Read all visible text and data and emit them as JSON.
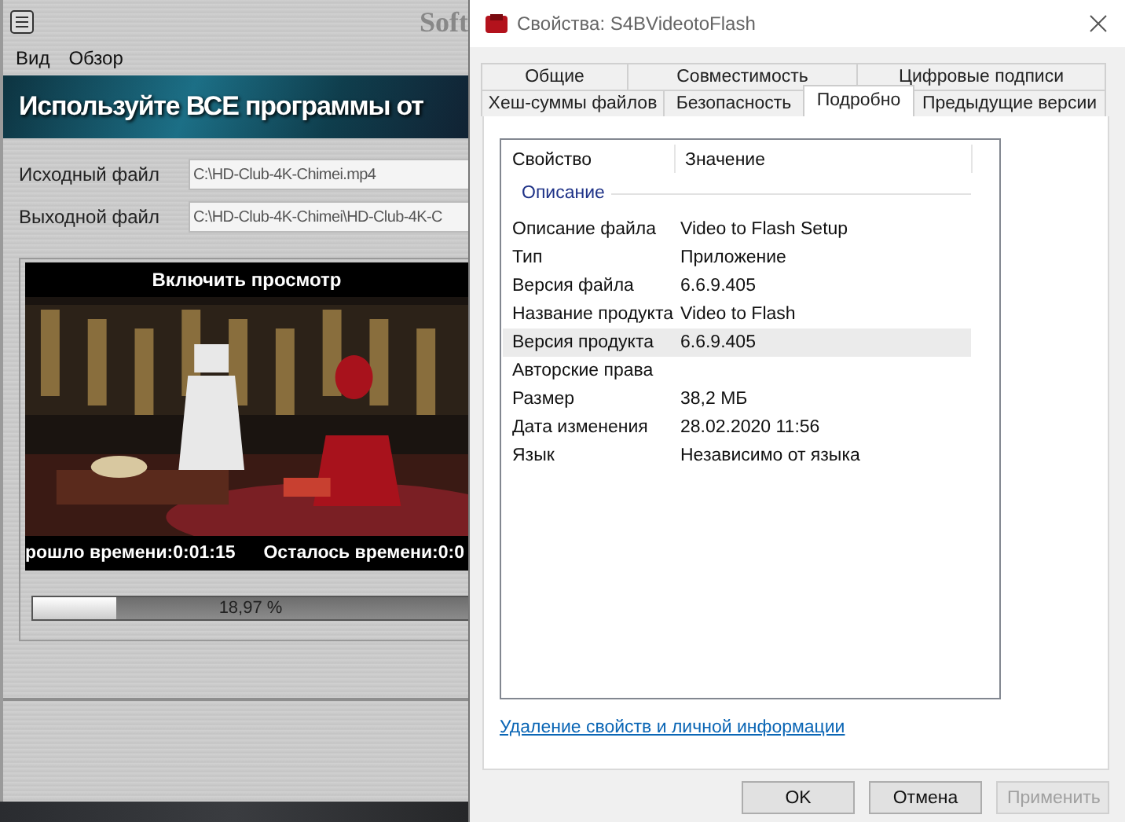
{
  "main_window": {
    "title": "Soft",
    "menu": [
      "Вид",
      "Обзор"
    ],
    "banner": "Используйте ВСЕ программы от",
    "fields": [
      {
        "label": "Исходный файл",
        "value": "C:\\HD-Club-4K-Chimei.mp4"
      },
      {
        "label": "Выходной файл",
        "value": "C:\\HD-Club-4K-Chimei\\HD-Club-4K-C"
      }
    ],
    "preview": {
      "header": "Включить просмотр",
      "kind": "picture",
      "elapsed": "рошло времени:0:01:15",
      "remaining": "Осталось времени:0:0"
    },
    "progress": {
      "level": 0.19,
      "reading": "18,97 %"
    }
  },
  "dialog": {
    "title": "Свойства: S4BVideotoFlash",
    "tab_rows": [
      [
        {
          "label": "Общие",
          "selected": false
        },
        {
          "label": "Совместимость",
          "selected": false
        },
        {
          "label": "Цифровые подписи",
          "selected": false
        }
      ],
      [
        {
          "label": "Хеш-суммы файлов",
          "selected": false
        },
        {
          "label": "Безопасность",
          "selected": false
        },
        {
          "label": "Подробно",
          "selected": true
        },
        {
          "label": "Предыдущие версии",
          "selected": false
        }
      ]
    ],
    "list": {
      "columns": [
        "Свойство",
        "Значение"
      ],
      "group": "Описание",
      "rows": [
        {
          "property": "Описание файла",
          "value": "Video to Flash Setup",
          "selected": false
        },
        {
          "property": "Тип",
          "value": "Приложение",
          "selected": false
        },
        {
          "property": "Версия файла",
          "value": "6.6.9.405",
          "selected": false
        },
        {
          "property": "Название продукта",
          "value": "Video to Flash",
          "selected": false
        },
        {
          "property": "Версия продукта",
          "value": "6.6.9.405",
          "selected": true
        },
        {
          "property": "Авторские права",
          "selected": false
        },
        {
          "property": "Размер",
          "value": "38,2 МБ",
          "selected": false
        },
        {
          "property": "Дата изменения",
          "value": "28.02.2020 11:56",
          "selected": false
        },
        {
          "property": "Язык",
          "value": "Независимо от языка",
          "selected": false
        }
      ]
    },
    "link": "Удаление свойств и личной информации",
    "buttons": [
      {
        "label": "OK",
        "disabled": false
      },
      {
        "label": "Отмена",
        "disabled": false
      },
      {
        "label": "Применить",
        "disabled": true
      }
    ]
  }
}
